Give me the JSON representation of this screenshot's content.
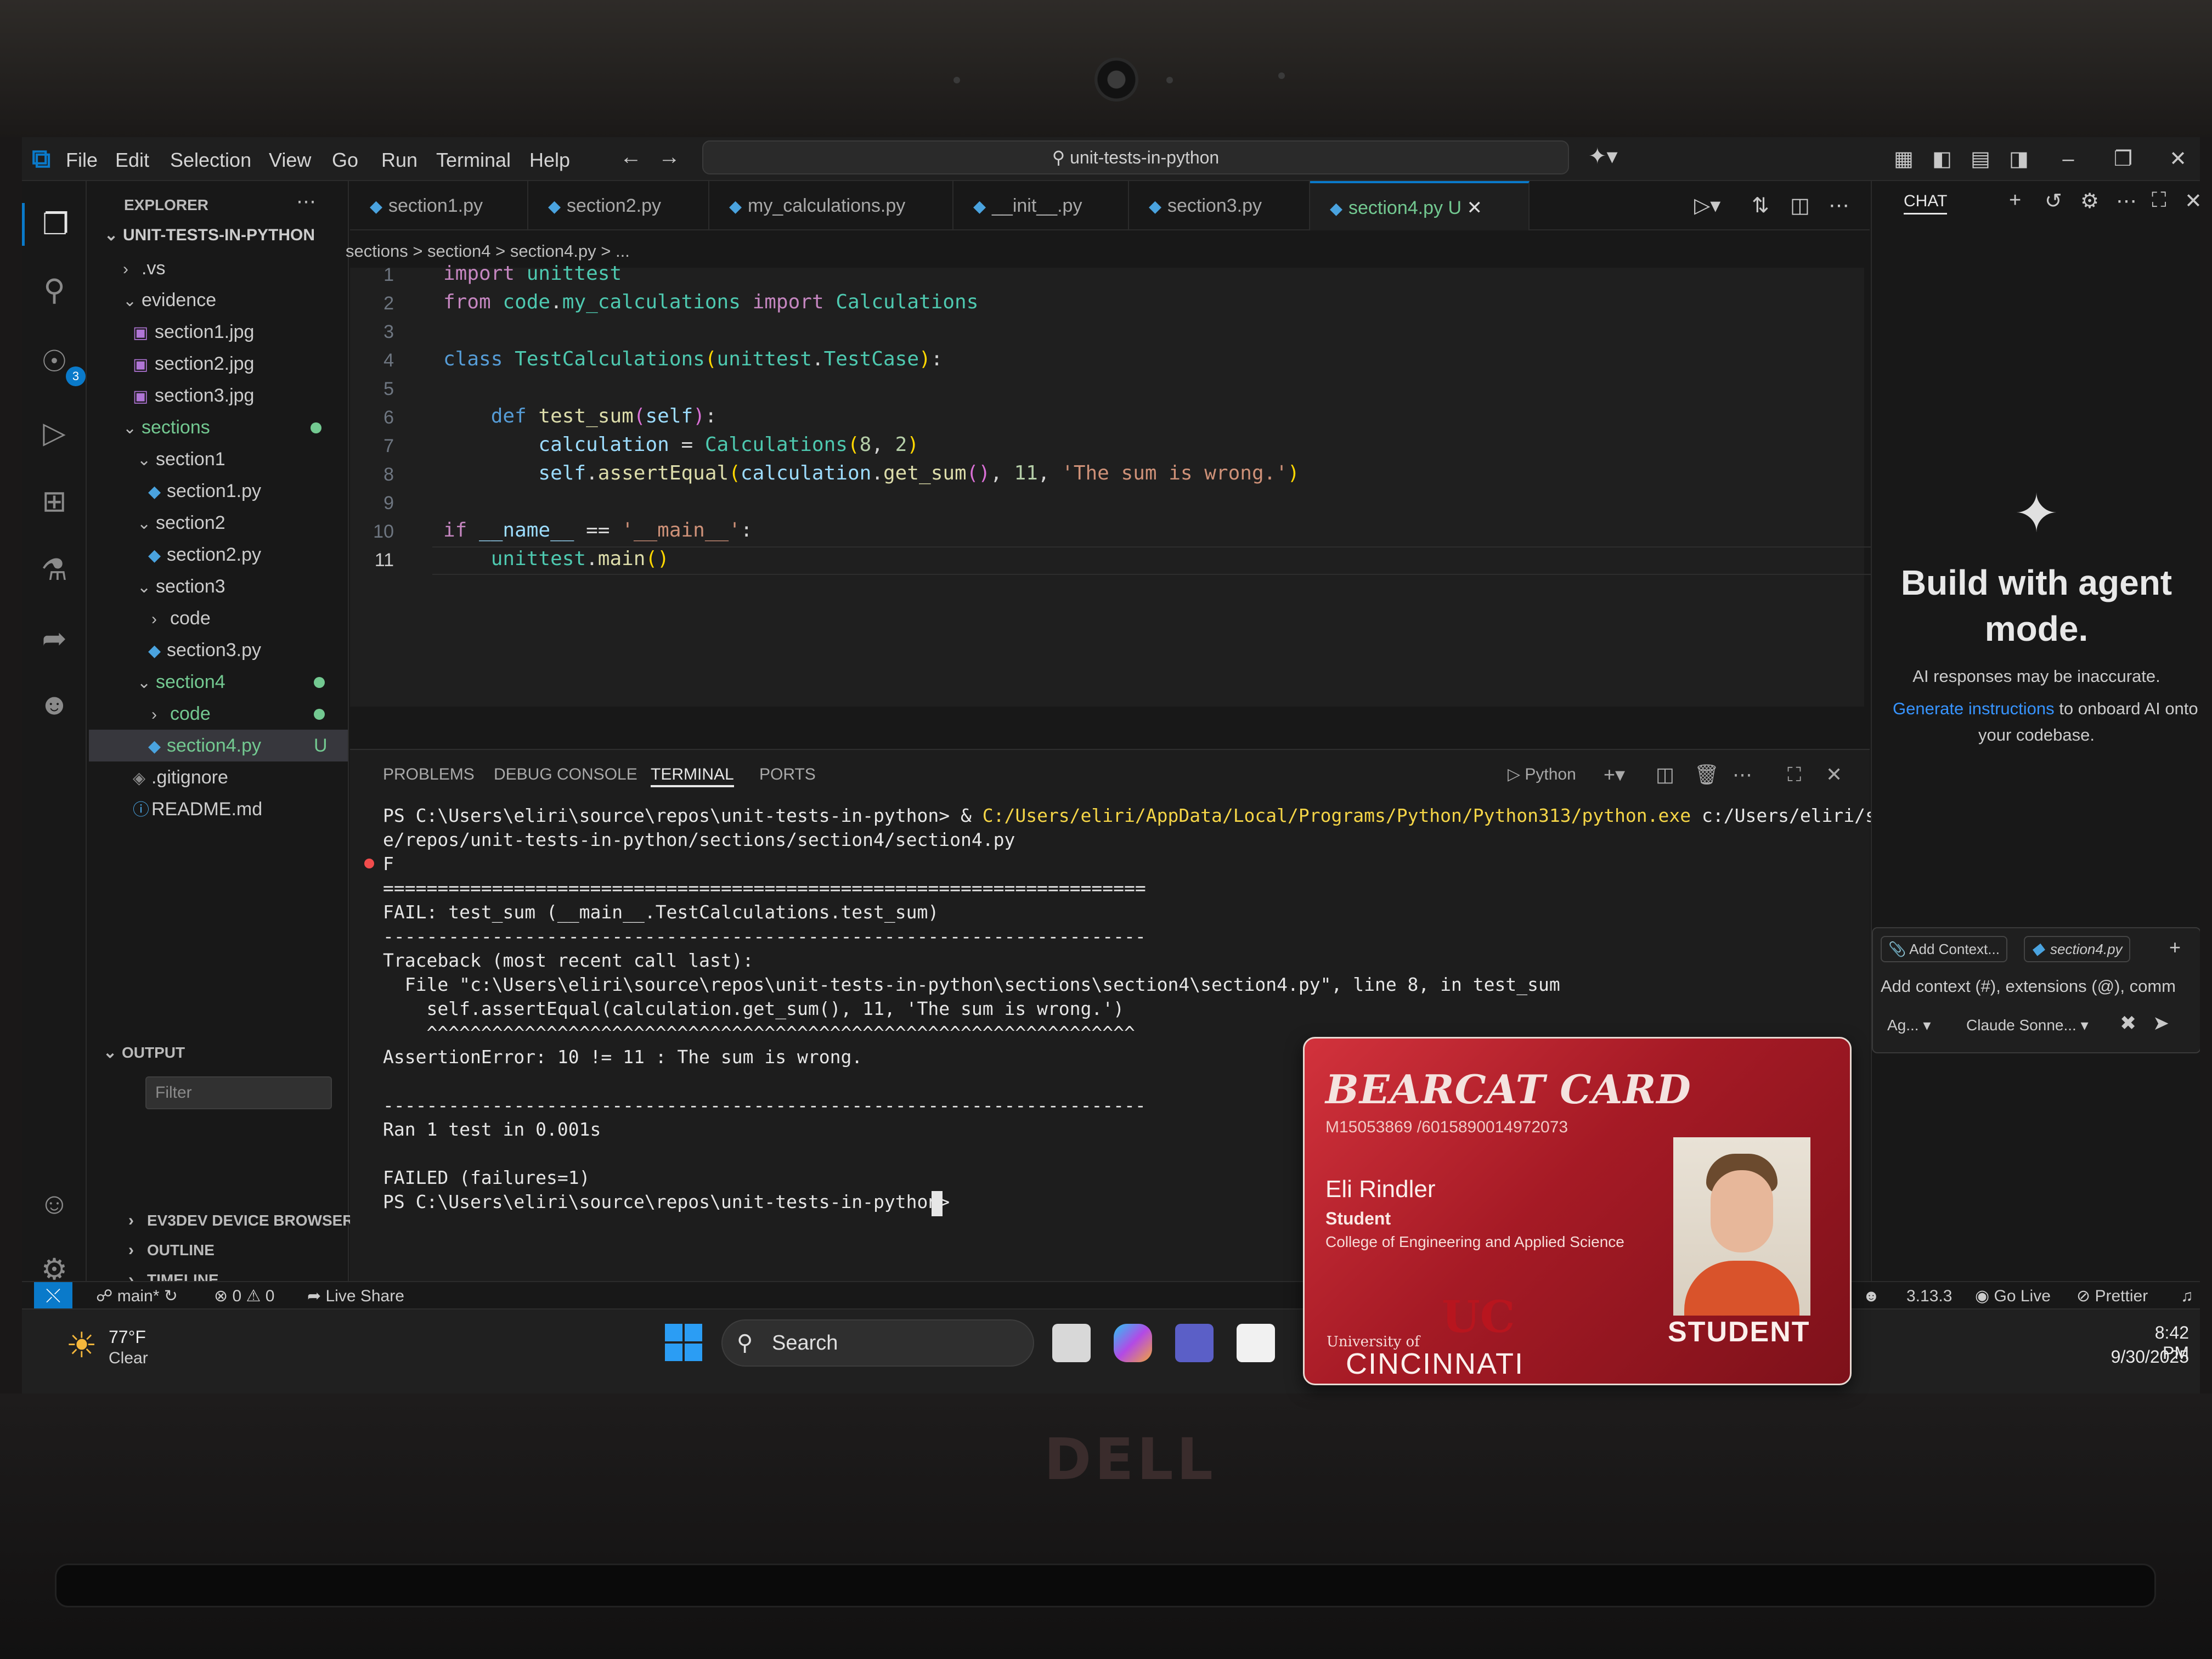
{
  "vscode": {
    "menu": [
      "File",
      "Edit",
      "Selection",
      "View",
      "Go",
      "Run",
      "Terminal",
      "Help"
    ],
    "command_center": "unit-tests-in-python",
    "explorer": {
      "header": "EXPLORER",
      "root": "UNIT-TESTS-IN-PYTHON",
      "items": [
        {
          "label": ".vs",
          "depth": 1,
          "kind": "folder-collapsed"
        },
        {
          "label": "evidence",
          "depth": 1,
          "kind": "folder-open"
        },
        {
          "label": "section1.jpg",
          "depth": 2,
          "kind": "image"
        },
        {
          "label": "section2.jpg",
          "depth": 2,
          "kind": "image"
        },
        {
          "label": "section3.jpg",
          "depth": 2,
          "kind": "image"
        },
        {
          "label": "sections",
          "depth": 1,
          "kind": "folder-open",
          "modified": true
        },
        {
          "label": "section1",
          "depth": 2,
          "kind": "folder-open"
        },
        {
          "label": "section1.py",
          "depth": 3,
          "kind": "python"
        },
        {
          "label": "section2",
          "depth": 2,
          "kind": "folder-open"
        },
        {
          "label": "section2.py",
          "depth": 3,
          "kind": "python"
        },
        {
          "label": "section3",
          "depth": 2,
          "kind": "folder-open"
        },
        {
          "label": "code",
          "depth": 3,
          "kind": "folder-collapsed"
        },
        {
          "label": "section3.py",
          "depth": 3,
          "kind": "python"
        },
        {
          "label": "section4",
          "depth": 2,
          "kind": "folder-open",
          "modified": true
        },
        {
          "label": "code",
          "depth": 3,
          "kind": "folder-collapsed",
          "modified": true
        },
        {
          "label": "section4.py",
          "depth": 3,
          "kind": "python",
          "badge": "U",
          "selected": true
        },
        {
          "label": ".gitignore",
          "depth": 1,
          "kind": "gitignore"
        },
        {
          "label": "README.md",
          "depth": 1,
          "kind": "info"
        }
      ],
      "output_header": "OUTPUT",
      "filter_placeholder": "Filter",
      "bottom_sections": [
        "EV3DEV DEVICE BROWSER",
        "OUTLINE",
        "TIMELINE"
      ]
    },
    "tabs": [
      {
        "label": "section1.py"
      },
      {
        "label": "section2.py"
      },
      {
        "label": "my_calculations.py"
      },
      {
        "label": "__init__.py"
      },
      {
        "label": "section3.py"
      },
      {
        "label": "section4.py",
        "badge": "U",
        "active": true
      }
    ],
    "breadcrumbs": "sections > section4 > section4.py > ...",
    "code_lines": [
      "1",
      "2",
      "3",
      "4",
      "5",
      "6",
      "7",
      "8",
      "9",
      "10",
      "11"
    ],
    "panel": {
      "tabs": [
        "PROBLEMS",
        "DEBUG CONSOLE",
        "TERMINAL",
        "PORTS"
      ],
      "active_tab": "TERMINAL",
      "shell_label": "Python",
      "terminal_lines": [
        "PS C:\\Users\\eliri\\source\\repos\\unit-tests-in-python> & C:/Users/eliri/AppData/Local/Programs/Python/Python313/python.exe c:/Users/eliri/sourc",
        "e/repos/unit-tests-in-python/sections/section4/section4.py",
        "F",
        "======================================================================",
        "FAIL: test_sum (__main__.TestCalculations.test_sum)",
        "----------------------------------------------------------------------",
        "Traceback (most recent call last):",
        "  File \"c:\\Users\\eliri\\source\\repos\\unit-tests-in-python\\sections\\section4\\section4.py\", line 8, in test_sum",
        "    self.assertEqual(calculation.get_sum(), 11, 'The sum is wrong.')",
        "    ^^^^^^^^^^^^^^^^^^^^^^^^^^^^^^^^^^^^^^^^^^^^^^^^^^^^^^^^^^^^^^^^^",
        "AssertionError: 10 != 11 : The sum is wrong.",
        "",
        "----------------------------------------------------------------------",
        "Ran 1 test in 0.001s",
        "",
        "FAILED (failures=1)",
        "PS C:\\Users\\eliri\\source\\repos\\unit-tests-in-python> "
      ]
    },
    "chat": {
      "tab": "CHAT",
      "title": "Build with agent mode.",
      "disclaimer": "AI responses may be inaccurate.",
      "link_text": "Generate instructions",
      "instructions_rest": "to onboard AI onto",
      "instructions_end": "your codebase.",
      "add_context": "Add Context...",
      "context_file": "section4.py",
      "input_placeholder": "Add context (#), extensions (@), comm",
      "mode": "Ag...",
      "model": "Claude Sonne..."
    },
    "status_bar": {
      "branch": "main*",
      "errors": "0",
      "warnings": "0",
      "live_share": "Live Share",
      "python_version": "3.13.3",
      "go_live": "Go Live",
      "prettier": "Prettier"
    }
  },
  "taskbar": {
    "weather_temp": "77°F",
    "weather_desc": "Clear",
    "search": "Search",
    "time": "8:42 PM",
    "date": "9/30/2025"
  },
  "id_card": {
    "title": "BEARCAT CARD",
    "number": "M15053869 /6015890014972073",
    "name": "Eli Rindler",
    "role": "Student",
    "college": "College of Engineering and Applied Science",
    "university_line1": "University of",
    "university_line2": "CINCINNATI",
    "status": "STUDENT"
  },
  "hardware": {
    "brand": "DELL"
  }
}
